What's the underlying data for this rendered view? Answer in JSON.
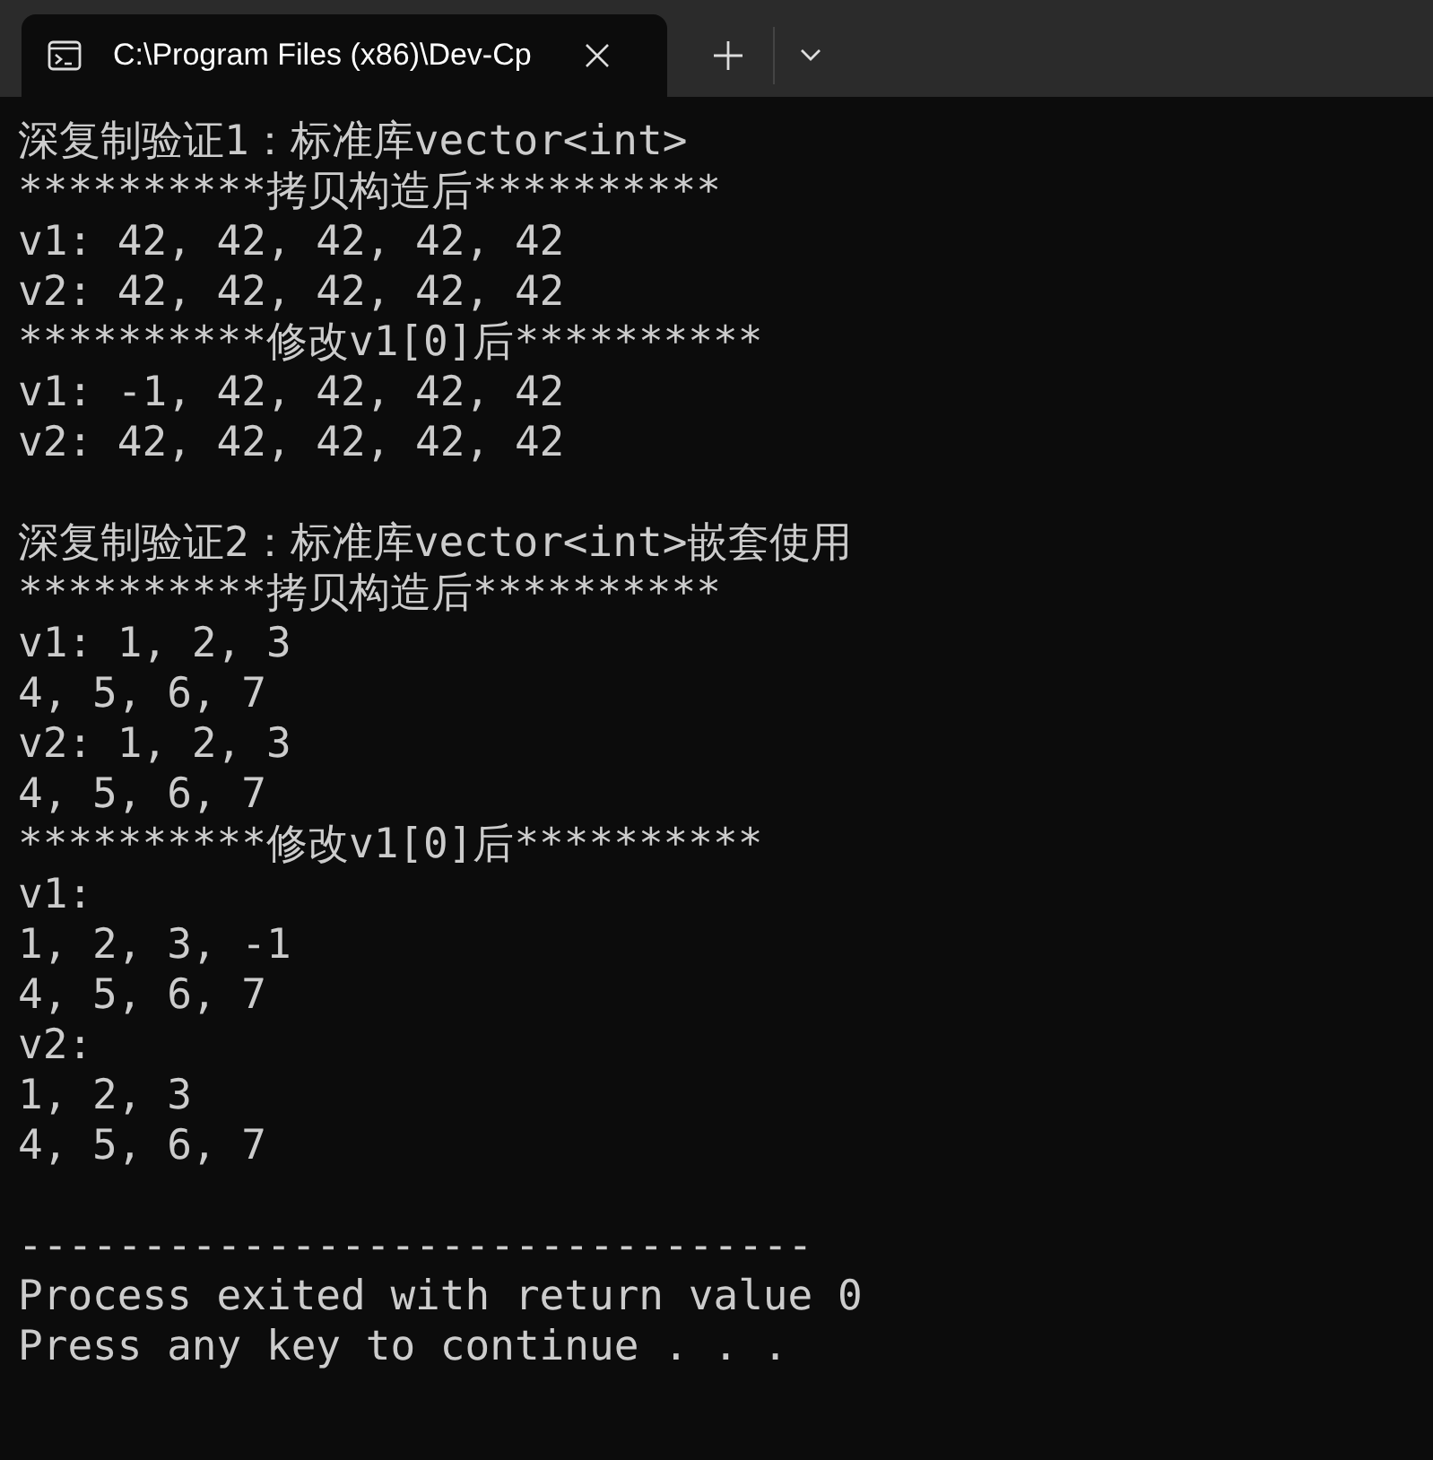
{
  "tabs": [
    {
      "title": "C:\\Program Files (x86)\\Dev-Cp",
      "selected": true
    }
  ],
  "console": {
    "blocks": [
      [
        "深复制验证1：标准库vector<int>",
        "**********拷贝构造后**********",
        "v1: 42, 42, 42, 42, 42",
        "v2: 42, 42, 42, 42, 42",
        "**********修改v1[0]后**********",
        "v1: -1, 42, 42, 42, 42",
        "v2: 42, 42, 42, 42, 42"
      ],
      [
        "深复制验证2：标准库vector<int>嵌套使用",
        "**********拷贝构造后**********",
        "v1: 1, 2, 3",
        "4, 5, 6, 7",
        "v2: 1, 2, 3",
        "4, 5, 6, 7",
        "**********修改v1[0]后**********",
        "v1:",
        "1, 2, 3, -1",
        "4, 5, 6, 7",
        "v2:",
        "1, 2, 3",
        "4, 5, 6, 7"
      ],
      [
        "--------------------------------",
        "Process exited with return value 0",
        "Press any key to continue . . ."
      ]
    ]
  }
}
